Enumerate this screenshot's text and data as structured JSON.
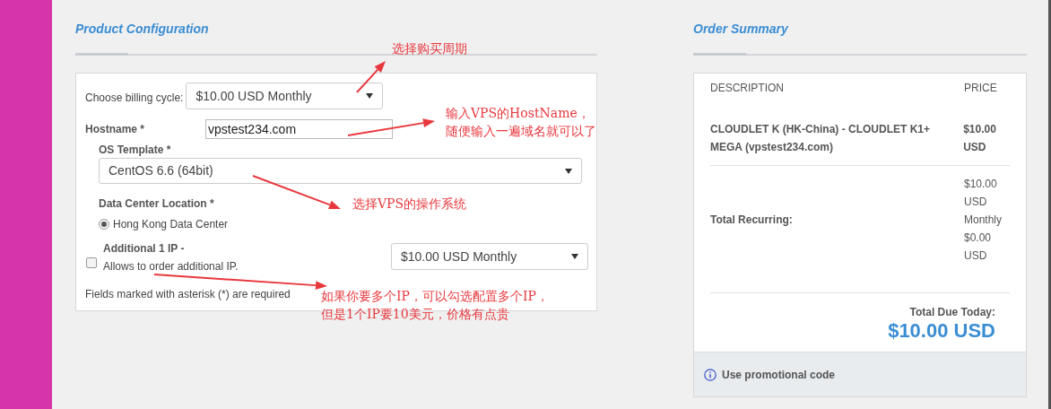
{
  "product_configuration": {
    "title": "Product Configuration",
    "billing_cycle": {
      "label": "Choose billing cycle:",
      "value": "$10.00 USD Monthly"
    },
    "hostname": {
      "label": "Hostname *",
      "value": "vpstest234.com"
    },
    "os_template": {
      "label": "OS Template *",
      "value": "CentOS 6.6 (64bit)"
    },
    "data_center": {
      "label": "Data Center Location *",
      "options": [
        {
          "label": "Hong Kong Data Center",
          "selected": true
        }
      ]
    },
    "additional_ip": {
      "label": "Additional 1 IP -",
      "checkbox_label": "Allows to order additional IP.",
      "checked": false,
      "value": "$10.00 USD Monthly"
    },
    "required_note": "Fields marked with asterisk (*) are required"
  },
  "order_summary": {
    "title": "Order Summary",
    "columns": [
      "DESCRIPTION",
      "PRICE"
    ],
    "items": [
      {
        "description": "CLOUDLET K (HK-China) - CLOUDLET K1+ MEGA (vpstest234.com)",
        "price": "$10.00 USD"
      }
    ],
    "total_recurring": {
      "label": "Total Recurring:",
      "lines": [
        "$10.00 USD Monthly",
        "$0.00 USD"
      ]
    },
    "total_due": {
      "label": "Total Due Today:",
      "value": "$10.00 USD"
    },
    "promo_link": "Use promotional code"
  },
  "annotations": [
    {
      "lines": [
        "选择购买周期"
      ]
    },
    {
      "lines": [
        "输入VPS的HostName，",
        "随便输入一遍域名就可以了"
      ]
    },
    {
      "lines": [
        "选择VPS的操作系统"
      ]
    },
    {
      "lines": [
        "如果你要多个IP，可以勾选配置多个IP，",
        "但是1个IP要10美元，价格有点贵"
      ]
    }
  ]
}
